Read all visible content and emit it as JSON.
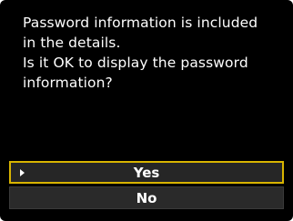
{
  "dialog": {
    "message_lines": [
      "Password information is included",
      "in the details.",
      "Is it OK to display the password",
      "information?"
    ]
  },
  "options": [
    {
      "label": "Yes",
      "selected": true
    },
    {
      "label": "No",
      "selected": false
    }
  ],
  "colors": {
    "background": "#000000",
    "selection_border": "#d8b400",
    "button_fill": "#2a2a2a",
    "text": "#ffffff"
  },
  "icons": {
    "selection_marker": "caret-right-icon"
  }
}
